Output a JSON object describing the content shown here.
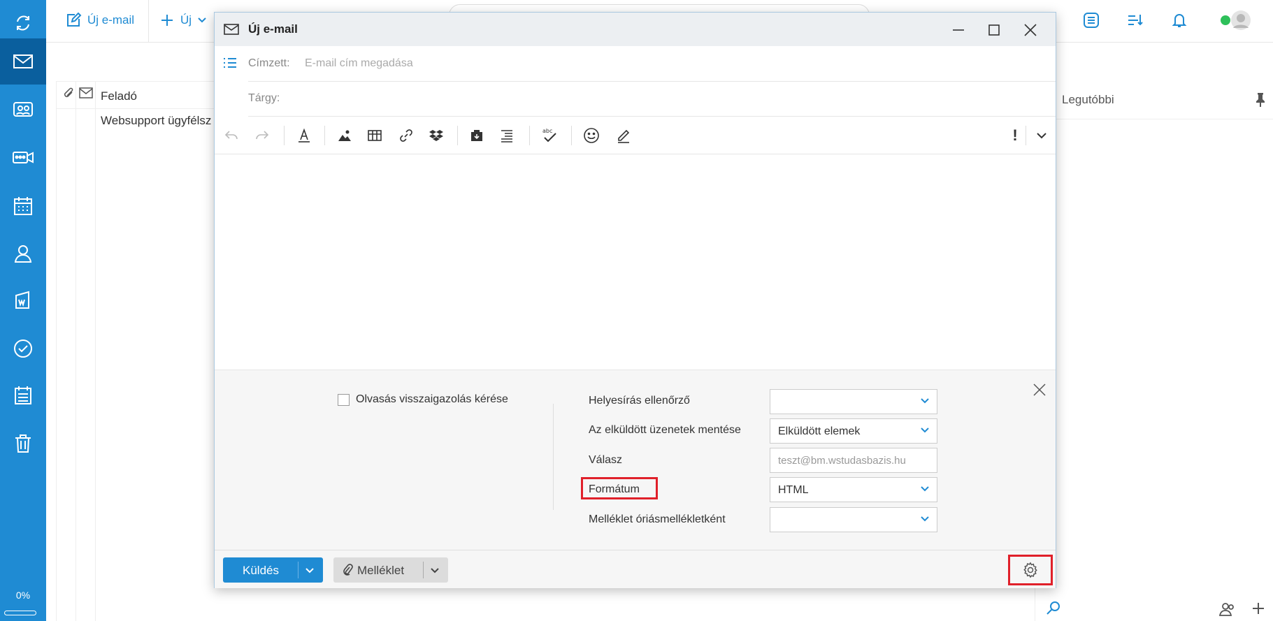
{
  "sidebar": {
    "items": [
      {
        "icon": "sync-icon"
      },
      {
        "icon": "mail-icon"
      },
      {
        "icon": "chat-icon"
      },
      {
        "icon": "video-icon"
      },
      {
        "icon": "calendar-icon"
      },
      {
        "icon": "contact-icon"
      },
      {
        "icon": "office-icon"
      },
      {
        "icon": "check-icon"
      },
      {
        "icon": "tasks-icon"
      },
      {
        "icon": "trash-icon"
      }
    ],
    "storage_label": "0%",
    "storage_fraction": 0.0
  },
  "topbar": {
    "new_email_label": "Új e-mail",
    "new_label": "Új"
  },
  "list": {
    "column_sender": "Feladó",
    "rows": [
      {
        "sender": "Websupport ügyfélsz"
      }
    ]
  },
  "right_panel": {
    "label": "Legutóbbi"
  },
  "dialog": {
    "title": "Új e-mail",
    "to_label": "Címzett:",
    "to_placeholder": "E-mail cím megadása",
    "subject_label": "Tárgy:",
    "priority_label": "!",
    "toolbar_icons": [
      "undo-icon",
      "redo-icon",
      "font-color-icon",
      "image-icon",
      "table-icon",
      "link-icon",
      "dropbox-icon",
      "template-icon",
      "align-icon",
      "spellcheck-icon",
      "emoji-icon",
      "signature-icon"
    ],
    "options": {
      "read_receipt_label": "Olvasás visszaigazolás kérése",
      "fields": [
        {
          "label": "Helyesírás ellenőrző",
          "value": ""
        },
        {
          "label": "Az elküldött üzenetek mentése",
          "value": "Elküldött elemek"
        },
        {
          "label": "Válasz",
          "value": "teszt@bm.wstudasbazis.hu"
        },
        {
          "label": "Formátum",
          "value": "HTML"
        },
        {
          "label": "Melléklet óriásmellékletként",
          "value": ""
        }
      ]
    },
    "footer": {
      "send_label": "Küldés",
      "attach_label": "Melléklet"
    }
  },
  "colors": {
    "accent": "#1f8bd3",
    "highlight": "#e0202a"
  }
}
